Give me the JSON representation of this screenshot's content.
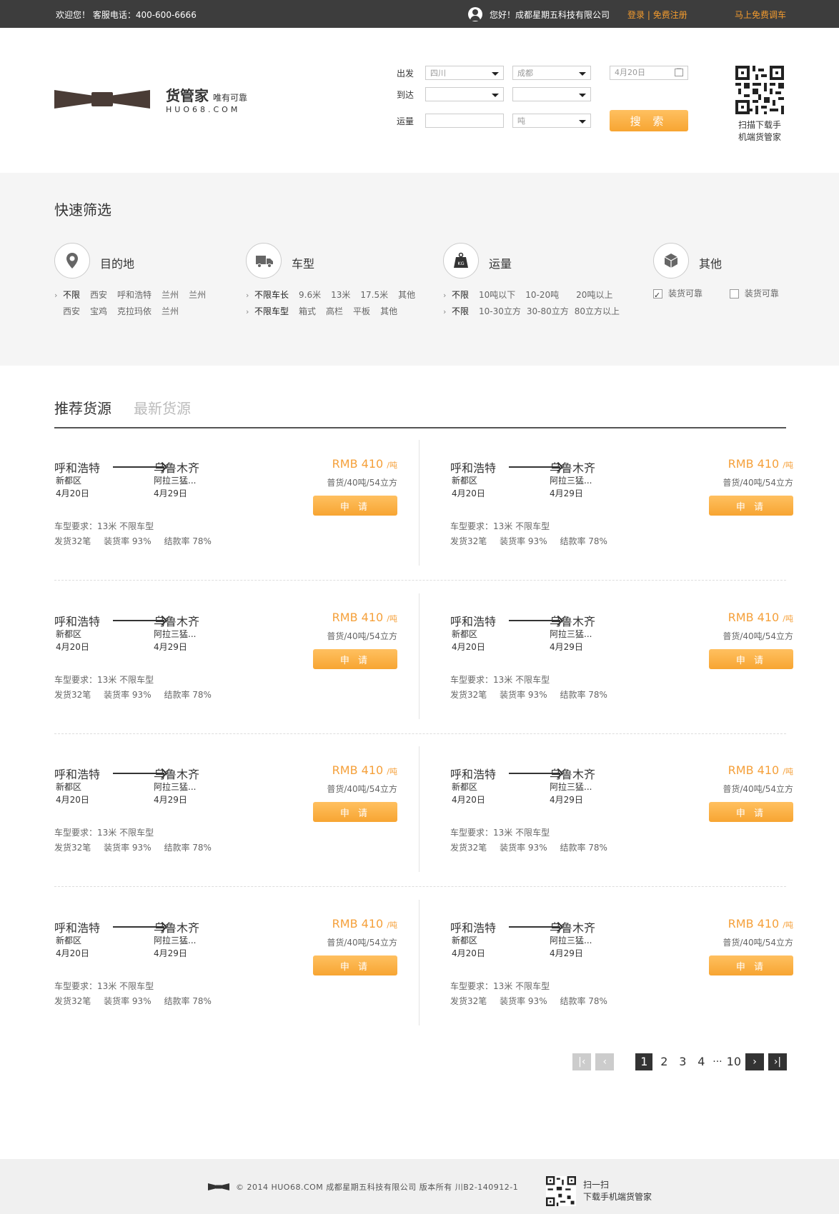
{
  "topbar": {
    "welcome": "欢迎您！ 客服电话：400-600-6666",
    "greeting": "您好！成都星期五科技有限公司",
    "login": "登录",
    "sep": "|",
    "register": "免费注册",
    "dispatch": "马上免费调车"
  },
  "logo": {
    "name": "货管家",
    "slogan": "唯有可靠",
    "en": "HUO68.COM"
  },
  "search": {
    "depart_label": "出发",
    "depart_province": "四川",
    "depart_city": "成都",
    "date": "4月20日",
    "arrive_label": "到达",
    "arrive_province": "",
    "arrive_city": "",
    "volume_label": "运量",
    "volume_unit": "吨",
    "button": "搜 索"
  },
  "qr": {
    "line1": "扫描下载手",
    "line2": "机端货管家"
  },
  "filter": {
    "title": "快速筛选",
    "groups": [
      {
        "title": "目的地",
        "icon": "location-pin-icon",
        "line1": [
          "不限",
          "西安",
          "呼和浩特",
          "兰州",
          "兰州"
        ],
        "line2": [
          "西安",
          "宝鸡",
          "克拉玛依",
          "兰州"
        ]
      },
      {
        "title": "车型",
        "icon": "truck-icon",
        "line1": [
          "不限车长",
          "9.6米",
          "13米",
          "17.5米",
          "其他"
        ],
        "line2": [
          "不限车型",
          "箱式",
          "高栏",
          "平板",
          "其他"
        ]
      },
      {
        "title": "运量",
        "icon": "weight-icon",
        "weight_badge": "KG",
        "line1": [
          "不限",
          "10吨以下",
          "10-20吨",
          "20吨以上"
        ],
        "line2": [
          "不限",
          "10-30立方",
          "30-80立方",
          "80立方以上"
        ]
      },
      {
        "title": "其他",
        "icon": "box-icon",
        "options": [
          {
            "label": "装货可靠",
            "checked": true
          },
          {
            "label": "装货可靠",
            "checked": false
          }
        ]
      }
    ]
  },
  "tabs": {
    "recommended": "推荐货源",
    "latest": "最新货源"
  },
  "card": {
    "from": "呼和浩特",
    "to": "乌鲁木齐",
    "from_district": "新都区",
    "from_date": "4月20日",
    "to_district": "阿拉三猛...",
    "to_date": "4月29日",
    "price": "RMB 410",
    "price_unit": "/吨",
    "spec": "普货/40吨/54立方",
    "apply": "申 请",
    "vehicle_req": "车型要求：13米  不限车型",
    "shipments": "发货32笔",
    "loading_rate": "装货率 93%",
    "settle_rate": "结款率 78%"
  },
  "pagination": {
    "pages": [
      "1",
      "2",
      "3",
      "4"
    ],
    "ellipsis": "···",
    "last": "10",
    "current": "1"
  },
  "footer": {
    "copyright": "© 2014 HUO68.COM 成都星期五科技有限公司 版本所有  川B2-140912-1",
    "qr_line1": "扫一扫",
    "qr_line2": "下载手机端货管家"
  }
}
